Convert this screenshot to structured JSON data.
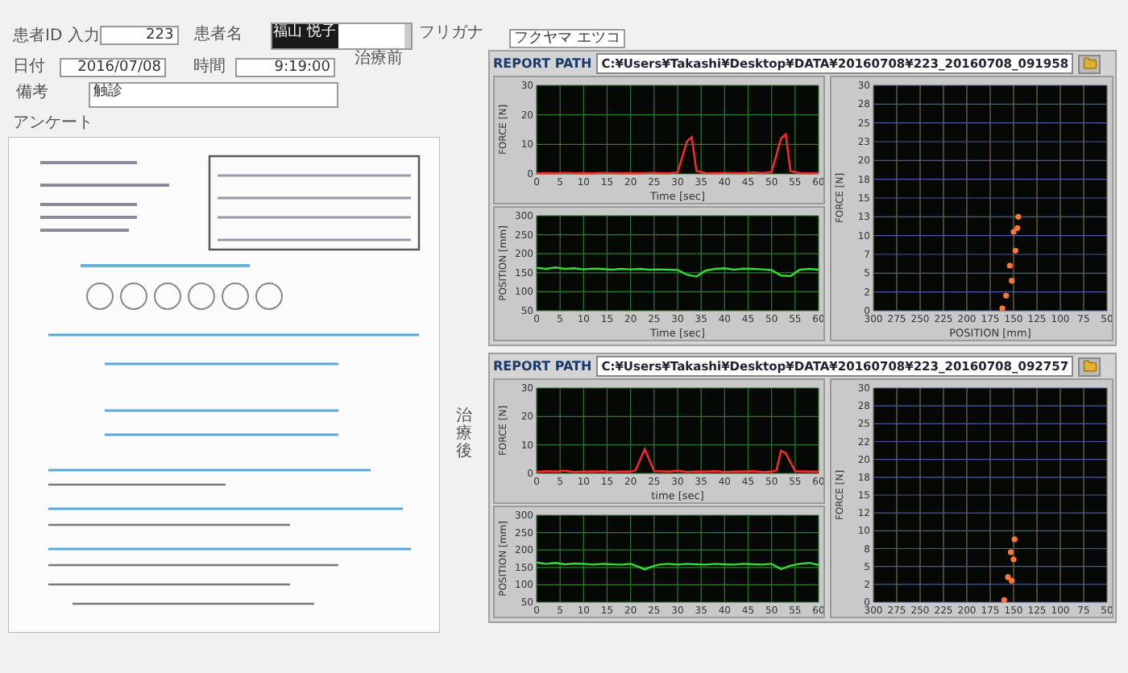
{
  "form": {
    "patient_id": {
      "label": "患者ID 入力",
      "value": "223"
    },
    "patient_name": {
      "label": "患者名",
      "value": "福山 悦子",
      "selected": true
    },
    "furigana": {
      "label": "フリガナ",
      "value": "フクヤマ エツコ"
    },
    "date": {
      "label": "日付",
      "value": "2016/07/08"
    },
    "time": {
      "label": "時間",
      "value": "9:19:00"
    },
    "remarks": {
      "label": "備考",
      "value": "触診"
    }
  },
  "questionnaire": {
    "label": "アンケート",
    "before_label": "治療前",
    "after_label": "治療後"
  },
  "reports": [
    {
      "path_label": "REPORT PATH",
      "path": "C:¥Users¥Takashi¥Desktop¥DATA¥20160708¥223_20160708_091958",
      "charts": [
        {
          "chart_data": {
            "type": "line",
            "xlabel": "Time [sec]",
            "ylabel": "FORCE [N]",
            "x": [
              0,
              2,
              4,
              6,
              8,
              10,
              12,
              14,
              16,
              18,
              20,
              22,
              24,
              26,
              28,
              30,
              32,
              33,
              34,
              36,
              38,
              40,
              42,
              44,
              46,
              48,
              50,
              52,
              53,
              54,
              56,
              58,
              60
            ],
            "xlim": [
              0,
              60
            ],
            "ylim": [
              0,
              30
            ],
            "xticks": [
              0,
              5,
              10,
              15,
              20,
              25,
              30,
              35,
              40,
              45,
              50,
              55,
              60
            ],
            "yticks": [
              0,
              10,
              20,
              30
            ],
            "grid": true,
            "series": [
              {
                "color": "#ff2a2a",
                "values": [
                  0.2,
                  0.3,
                  0.2,
                  0.4,
                  0.2,
                  0.3,
                  0.2,
                  0.4,
                  0.3,
                  0.2,
                  0.3,
                  0.2,
                  0.4,
                  0.3,
                  0.2,
                  0.5,
                  11,
                  12.5,
                  1,
                  0.3,
                  0.2,
                  0.4,
                  0.3,
                  0.2,
                  0.5,
                  0.3,
                  0.6,
                  12,
                  13.5,
                  1,
                  0.3,
                  0.2,
                  0.3
                ]
              }
            ]
          }
        },
        {
          "chart_data": {
            "type": "line",
            "xlabel": "Time [sec]",
            "ylabel": "POSITION [mm]",
            "x": [
              0,
              2,
              4,
              6,
              8,
              10,
              12,
              14,
              16,
              18,
              20,
              22,
              24,
              26,
              28,
              30,
              32,
              34,
              36,
              38,
              40,
              42,
              44,
              46,
              48,
              50,
              52,
              54,
              56,
              58,
              60
            ],
            "xlim": [
              0,
              60
            ],
            "ylim": [
              50,
              300
            ],
            "xticks": [
              0,
              5,
              10,
              15,
              20,
              25,
              30,
              35,
              40,
              45,
              50,
              55,
              60
            ],
            "yticks": [
              50,
              100,
              150,
              200,
              250,
              300
            ],
            "grid": true,
            "series": [
              {
                "color": "#33dd33",
                "values": [
                  163,
                  160,
                  164,
                  160,
                  162,
                  159,
                  161,
                  160,
                  158,
                  160,
                  159,
                  160,
                  158,
                  159,
                  158,
                  157,
                  145,
                  140,
                  156,
                  160,
                  162,
                  158,
                  161,
                  160,
                  159,
                  157,
                  143,
                  141,
                  158,
                  160,
                  158
                ]
              }
            ]
          }
        },
        {
          "chart_data": {
            "type": "scatter",
            "grid": true,
            "xlabel": "POSITION [mm]",
            "ylabel": "FORCE [N]",
            "x": [
              162,
              152,
              148,
              146,
              145,
              150,
              154,
              158
            ],
            "xlim": [
              300,
              50
            ],
            "ylim": [
              0,
              30
            ],
            "xticks": [
              300,
              275,
              250,
              225,
              200,
              175,
              150,
              125,
              100,
              75,
              50
            ],
            "yticks": [
              {
                "value": 0,
                "label": "0"
              },
              {
                "value": 2.5,
                "label": "2"
              },
              {
                "value": 5,
                "label": "5"
              },
              {
                "value": 7.5,
                "label": "7"
              },
              {
                "value": 10,
                "label": "10"
              },
              {
                "value": 12.5,
                "label": "13"
              },
              {
                "value": 15,
                "label": "15"
              },
              {
                "value": 17.5,
                "label": "18"
              },
              {
                "value": 20,
                "label": "20"
              },
              {
                "value": 22.5,
                "label": "23"
              },
              {
                "value": 25,
                "label": "25"
              },
              {
                "value": 27.5,
                "label": "28"
              },
              {
                "value": 30,
                "label": "30"
              }
            ],
            "series": [
              {
                "color": "#ff7733",
                "values": [
                  0.3,
                  4,
                  8,
                  11,
                  12.5,
                  10.5,
                  6,
                  2
                ]
              }
            ]
          }
        }
      ]
    },
    {
      "path_label": "REPORT PATH",
      "path": "C:¥Users¥Takashi¥Desktop¥DATA¥20160708¥223_20160708_092757",
      "charts": [
        {
          "chart_data": {
            "type": "line",
            "xlabel": "time [sec]",
            "ylabel": "FORCE [N]",
            "x": [
              0,
              2,
              4,
              6,
              8,
              10,
              12,
              14,
              16,
              18,
              20,
              21,
              23,
              25,
              28,
              30,
              32,
              34,
              36,
              38,
              40,
              42,
              44,
              46,
              48,
              50,
              51,
              52,
              53,
              55,
              58,
              60
            ],
            "xlim": [
              0,
              60
            ],
            "ylim": [
              0,
              30
            ],
            "xticks": [
              0,
              5,
              10,
              15,
              20,
              25,
              30,
              35,
              40,
              45,
              50,
              55,
              60
            ],
            "yticks": [
              0,
              10,
              20,
              30
            ],
            "grid": true,
            "series": [
              {
                "color": "#ff2a2a",
                "values": [
                  0.5,
                  0.8,
                  0.6,
                  0.9,
                  0.5,
                  0.7,
                  0.6,
                  0.8,
                  0.5,
                  0.7,
                  0.6,
                  1,
                  8.5,
                  0.8,
                  0.6,
                  0.9,
                  0.5,
                  0.7,
                  0.6,
                  0.8,
                  0.5,
                  0.7,
                  0.6,
                  0.8,
                  0.5,
                  0.6,
                  1,
                  8,
                  7,
                  0.8,
                  0.6,
                  0.7
                ]
              }
            ]
          }
        },
        {
          "chart_data": {
            "type": "line",
            "ylabel": "POSITION [mm]",
            "x": [
              0,
              2,
              4,
              6,
              8,
              10,
              12,
              14,
              16,
              18,
              20,
              22,
              23,
              24,
              26,
              28,
              30,
              32,
              34,
              36,
              38,
              40,
              42,
              44,
              46,
              48,
              50,
              52,
              54,
              56,
              58,
              60
            ],
            "xlim": [
              0,
              60
            ],
            "ylim": [
              50,
              300
            ],
            "xticks": [
              0,
              5,
              10,
              15,
              20,
              25,
              30,
              35,
              40,
              45,
              50,
              55,
              60
            ],
            "yticks": [
              50,
              100,
              150,
              200,
              250,
              300
            ],
            "grid": true,
            "series": [
              {
                "color": "#33dd33",
                "values": [
                  164,
                  160,
                  163,
                  159,
                  161,
                  160,
                  158,
                  160,
                  159,
                  158,
                  160,
                  150,
                  144,
                  150,
                  158,
                  160,
                  158,
                  160,
                  159,
                  158,
                  160,
                  159,
                  158,
                  160,
                  159,
                  158,
                  160,
                  145,
                  155,
                  160,
                  163,
                  157
                ]
              }
            ]
          }
        },
        {
          "chart_data": {
            "type": "scatter",
            "grid": true,
            "ylabel": "FORCE [N]",
            "x": [
              160,
              152,
              150,
              149,
              153,
              156
            ],
            "xlim": [
              300,
              50
            ],
            "ylim": [
              0,
              30
            ],
            "xticks": [
              300,
              275,
              250,
              225,
              200,
              175,
              150,
              125,
              100,
              75,
              50
            ],
            "yticks": [
              {
                "value": 0,
                "label": "0"
              },
              {
                "value": 2.5,
                "label": "2"
              },
              {
                "value": 5,
                "label": "5"
              },
              {
                "value": 7.5,
                "label": "8"
              },
              {
                "value": 10,
                "label": "10"
              },
              {
                "value": 12.5,
                "label": "12"
              },
              {
                "value": 15,
                "label": "15"
              },
              {
                "value": 17.5,
                "label": "18"
              },
              {
                "value": 20,
                "label": "20"
              },
              {
                "value": 22.5,
                "label": "22"
              },
              {
                "value": 25,
                "label": "25"
              },
              {
                "value": 27.5,
                "label": "28"
              },
              {
                "value": 30,
                "label": "30"
              }
            ],
            "series": [
              {
                "color": "#ff7733",
                "values": [
                  0.3,
                  3,
                  6,
                  8.8,
                  7,
                  3.5
                ]
              }
            ]
          }
        }
      ]
    }
  ]
}
